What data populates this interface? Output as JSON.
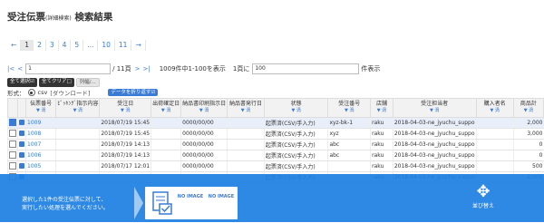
{
  "page": {
    "title": "受注伝票",
    "title_sub": "(詳細検索)",
    "title_suffix": "検索結果"
  },
  "pager": {
    "pages": [
      "←",
      "1",
      "2",
      "3",
      "4",
      "5",
      "...",
      "10",
      "11",
      "→"
    ],
    "active": "1"
  },
  "nav": {
    "first": "|<",
    "prev": "<",
    "page_value": "1",
    "total_pages": "/ 11頁",
    "next": ">",
    "last": ">|",
    "range_text": "1009件中1-100を表示",
    "per_page_label": "1頁に",
    "per_page_value": "100",
    "per_page_suffix": "件表示"
  },
  "actions": {
    "select_all": "全て選択☑",
    "clear_all": "全てクリア□",
    "collapse": "列幅/..."
  },
  "format": {
    "label": "形式：",
    "option": "csv",
    "download": "[ダウンロード]",
    "wrap_button": "データを折り返す☑"
  },
  "table": {
    "headers": [
      {
        "label": "",
        "sort": ""
      },
      {
        "label": "",
        "sort": ""
      },
      {
        "label": "伝票番号",
        "sort": "▼ 渦"
      },
      {
        "label": "ﾋﾟｯｷﾝｸﾞ指示内容",
        "sort": "▼ 渦"
      },
      {
        "label": "受注日",
        "sort": "▼ 渦"
      },
      {
        "label": "出荷確定日",
        "sort": "▼ 渦"
      },
      {
        "label": "納品書印刷指示日",
        "sort": "▼ 渦"
      },
      {
        "label": "納品書発行日",
        "sort": "▼ 渦"
      },
      {
        "label": "状態",
        "sort": "▼ 渦"
      },
      {
        "label": "受注番号",
        "sort": "▼ 渦"
      },
      {
        "label": "店舗",
        "sort": "▼ 渦"
      },
      {
        "label": "受注担当者",
        "sort": "▼ 渦"
      },
      {
        "label": "購入者名",
        "sort": "▼ 渦"
      },
      {
        "label": "商品計",
        "sort": "▼ 渦"
      }
    ],
    "rows": [
      {
        "checked": true,
        "cells": [
          "1009",
          "",
          "2018/07/19 15:45",
          "",
          "0000/00/00",
          "",
          "起票済(CSV/手入力)",
          "xyz-bk-1",
          "raku",
          "2018-04-03-ne_jyuchu_suppo",
          "",
          "2,000"
        ]
      },
      {
        "checked": false,
        "cells": [
          "1008",
          "",
          "2018/07/19 15:45",
          "",
          "0000/00/00",
          "",
          "起票済(CSV/手入力)",
          "xyz",
          "raku",
          "2018-04-03-ne_jyuchu_suppo",
          "",
          "3,000"
        ]
      },
      {
        "checked": false,
        "cells": [
          "1007",
          "",
          "2018/07/19 14:13",
          "",
          "0000/00/00",
          "",
          "起票済(CSV/手入力)",
          "abc",
          "raku",
          "2018-04-03-ne_jyuchu_suppo",
          "",
          "0"
        ]
      },
      {
        "checked": false,
        "cells": [
          "1006",
          "",
          "2018/07/19 14:13",
          "",
          "0000/00/00",
          "",
          "起票済(CSV/手入力)",
          "abc",
          "raku",
          "2018-04-03-ne_jyuchu_suppo",
          "",
          "0"
        ]
      },
      {
        "checked": false,
        "cells": [
          "1005",
          "",
          "2018/07/17 12:01",
          "",
          "0000/00/00",
          "",
          "起票済(CSV/手入力)",
          "",
          "raku",
          "2018-04-03-ne_jyuchu_suppo",
          "",
          "500"
        ]
      },
      {
        "checked": false,
        "cells": [
          "",
          "",
          "",
          "",
          "",
          "",
          "起票済(CSV/手入力)",
          "",
          "raku",
          "2018-04-03-ne_jyuchu_suppo",
          "",
          "2,000"
        ]
      }
    ]
  },
  "banner": {
    "message_line1": "選択した1件の受注伝票に対して、",
    "message_line2": "実行したい処理を選んでください。",
    "tile1_label": "",
    "tile2_label": "NO IMAGE",
    "tile3_label": "NO IMAGE",
    "swap_label": "並び替え",
    "swap_icon": "arrows-move-icon"
  },
  "colors": {
    "accent": "#3a7bd5",
    "banner": "#1e80e2"
  }
}
